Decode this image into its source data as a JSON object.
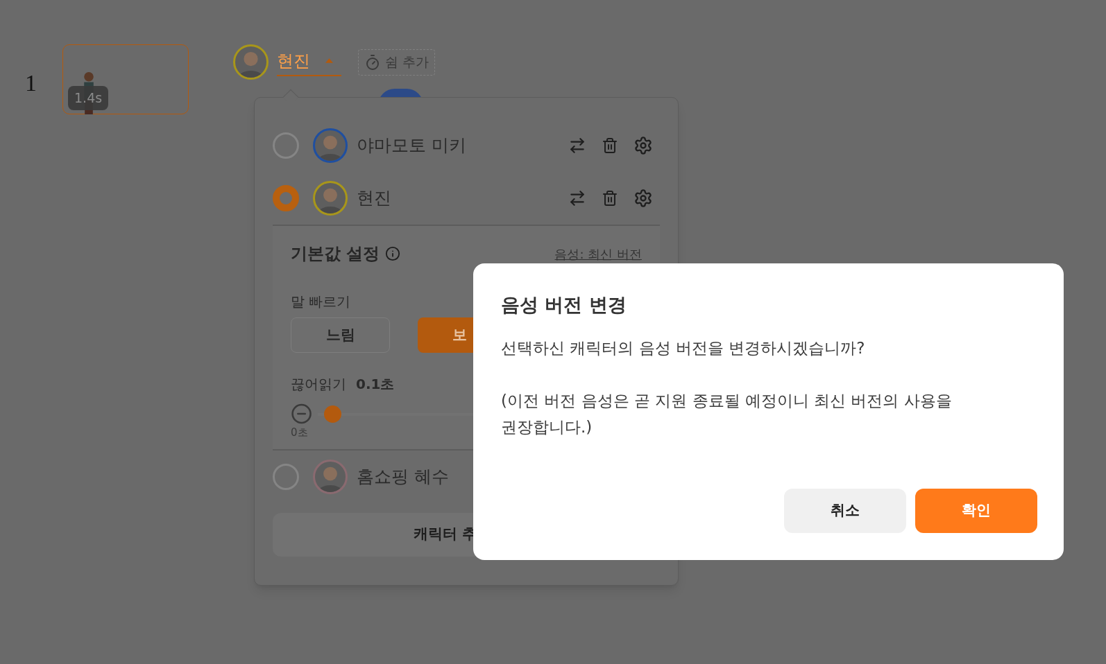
{
  "row_number": "1",
  "clip": {
    "duration": "1.4s"
  },
  "speaker": {
    "name": "현진",
    "expanded": true
  },
  "add_pause_button": {
    "label": "쉼 추가"
  },
  "character_menu": {
    "characters": [
      {
        "name": "야마모토 미키",
        "selected": false,
        "color": "#1f4fa0"
      },
      {
        "name": "현진",
        "selected": true,
        "color": "#a8961a"
      },
      {
        "name": "홈쇼핑 혜수",
        "selected": false,
        "color": "#8a6a70"
      }
    ],
    "default_settings": {
      "title": "기본값 설정",
      "voice_link": "음성: 최신 버전",
      "speed": {
        "label": "말 빠르기",
        "options": [
          {
            "label": "느림",
            "selected": false
          },
          {
            "label": "보",
            "selected": true
          }
        ]
      },
      "pause": {
        "label": "끊어읽기",
        "value": "0.1초",
        "level": 0.02,
        "min_label": "0초"
      }
    },
    "add_button": {
      "label": "캐릭터 추"
    }
  },
  "dialog": {
    "title": "음성 버전 변경",
    "paragraphs": [
      "선택하신 캐릭터의 음성 버전을 변경하시겠습니까?",
      "(이전 버전 음성은 곧 지원 종료될 예정이니 최신 버전의 사용을 권장합니다.)"
    ],
    "buttons": [
      {
        "label": "취소",
        "kind": "secondary"
      },
      {
        "label": "확인",
        "kind": "primary"
      }
    ]
  }
}
